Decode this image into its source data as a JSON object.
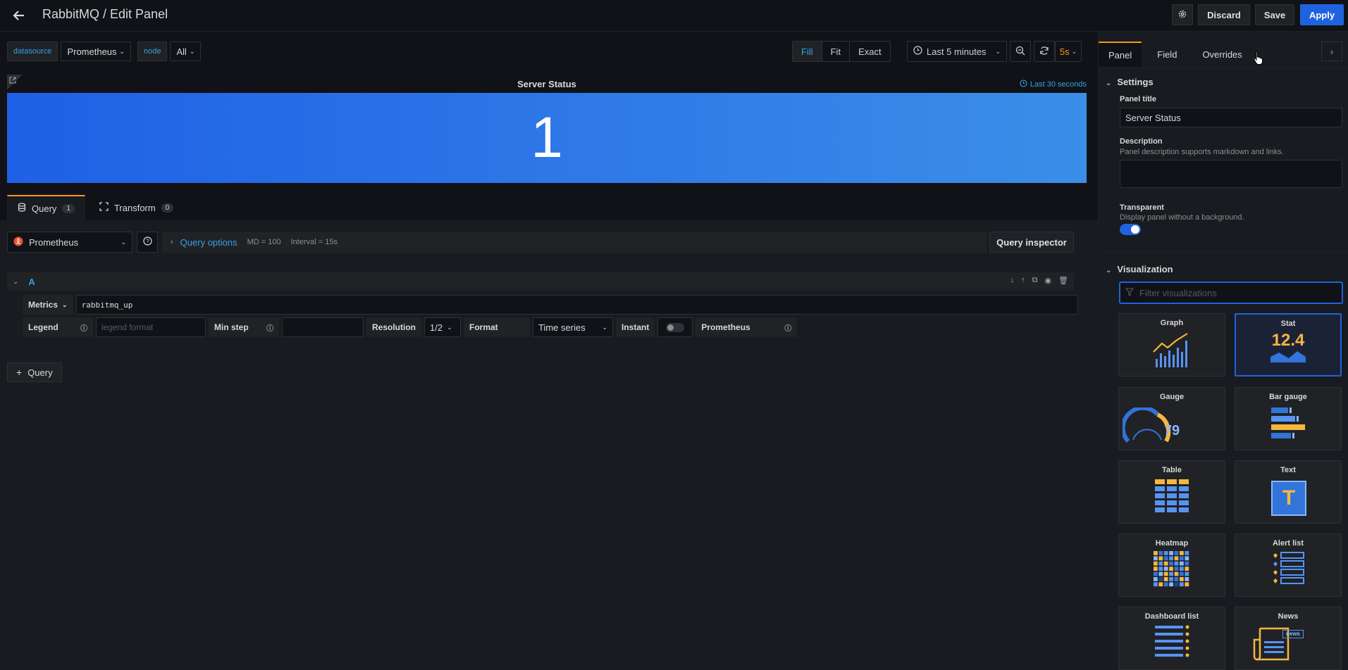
{
  "header": {
    "title": "RabbitMQ / Edit Panel",
    "discard_label": "Discard",
    "save_label": "Save",
    "apply_label": "Apply"
  },
  "variables": [
    {
      "label": "datasource",
      "value": "Prometheus"
    },
    {
      "label": "node",
      "value": "All"
    }
  ],
  "view_modes": [
    "Fill",
    "Fit",
    "Exact"
  ],
  "active_view_mode": "Fill",
  "time_range": "Last 5 minutes",
  "refresh_interval": "5s",
  "panel": {
    "title": "Server Status",
    "time_info": "Last 30 seconds",
    "stat_value": "1"
  },
  "query_tabs": [
    {
      "label": "Query",
      "count": "1"
    },
    {
      "label": "Transform",
      "count": "0"
    }
  ],
  "query_editor": {
    "datasource": "Prometheus",
    "options_label": "Query options",
    "md": "MD = 100",
    "interval": "Interval = 15s",
    "inspector_label": "Query inspector",
    "query_letter": "A",
    "metrics_label": "Metrics",
    "metrics_value": "rabbitmq_up",
    "legend_label": "Legend",
    "legend_placeholder": "legend format",
    "min_step_label": "Min step",
    "resolution_label": "Resolution",
    "resolution_value": "1/2",
    "format_label": "Format",
    "format_value": "Time series",
    "instant_label": "Instant",
    "prometheus_label": "Prometheus",
    "add_query_label": "Query"
  },
  "sidebar": {
    "tabs": [
      "Panel",
      "Field",
      "Overrides"
    ],
    "active_tab": "Panel",
    "settings_title": "Settings",
    "panel_title_label": "Panel title",
    "panel_title_value": "Server Status",
    "description_label": "Description",
    "description_hint": "Panel description supports markdown and links.",
    "transparent_label": "Transparent",
    "transparent_hint": "Display panel without a background.",
    "transparent_on": true,
    "visualization_title": "Visualization",
    "filter_placeholder": "Filter visualizations",
    "visualizations": [
      {
        "name": "Graph",
        "icon": "graph-icon"
      },
      {
        "name": "Stat",
        "icon": "stat-icon",
        "value": "12.4"
      },
      {
        "name": "Gauge",
        "icon": "gauge-icon",
        "value": "79"
      },
      {
        "name": "Bar gauge",
        "icon": "bar-gauge-icon"
      },
      {
        "name": "Table",
        "icon": "table-icon"
      },
      {
        "name": "Text",
        "icon": "text-icon",
        "glyph": "T"
      },
      {
        "name": "Heatmap",
        "icon": "heatmap-icon"
      },
      {
        "name": "Alert list",
        "icon": "alert-list-icon"
      },
      {
        "name": "Dashboard list",
        "icon": "dashboard-list-icon"
      },
      {
        "name": "News",
        "icon": "news-icon",
        "glyph": "news"
      }
    ],
    "selected_visualization": "Stat"
  },
  "colors": {
    "accent_blue": "#1f62e0",
    "link_blue": "#33a2e5",
    "orange": "#f79520"
  }
}
